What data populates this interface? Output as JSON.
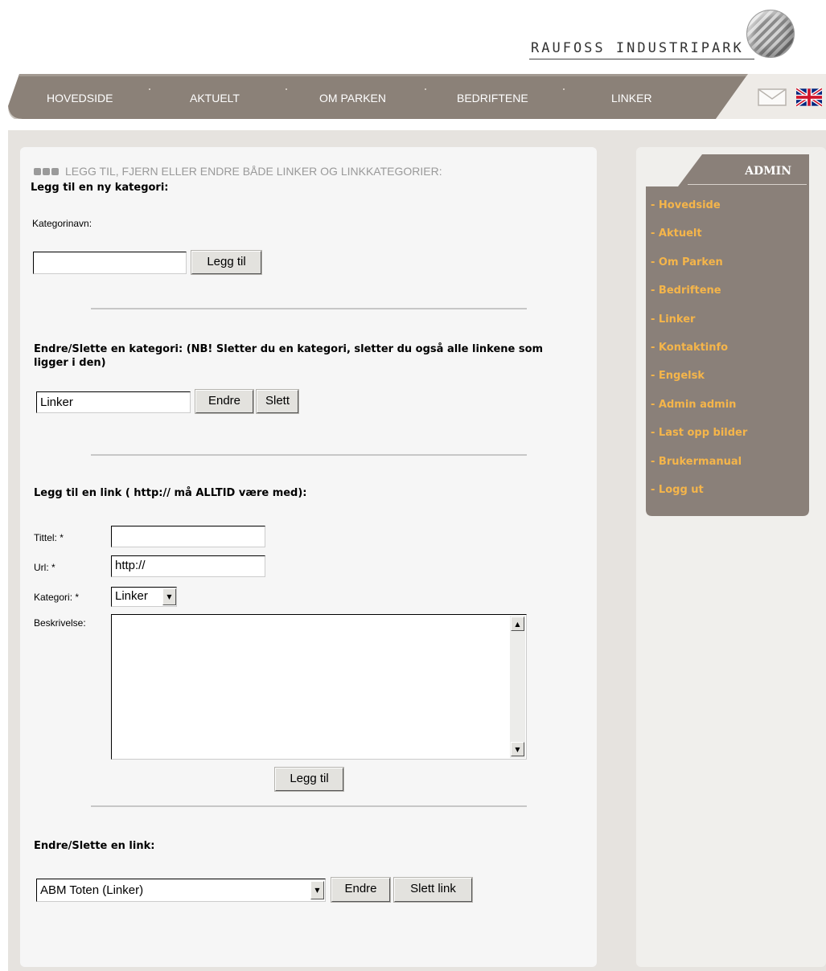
{
  "brand": {
    "logo_text": "RAUFOSS INDUSTRIPARK"
  },
  "nav": {
    "items": [
      {
        "label": "HOVEDSIDE"
      },
      {
        "label": "AKTUELT"
      },
      {
        "label": "OM PARKEN"
      },
      {
        "label": "BEDRIFTENE"
      },
      {
        "label": "LINKER"
      }
    ],
    "mail_icon": "mail-icon",
    "language_icon": "uk-flag-icon"
  },
  "main": {
    "heading": "LEGG TIL, FJERN ELLER ENDRE BÅDE LINKER OG LINKKATEGORIER:",
    "add_category": {
      "title": "Legg til en ny kategori:",
      "name_label": "Kategorinavn:",
      "name_value": "",
      "submit_label": "Legg til"
    },
    "edit_category": {
      "title": "Endre/Slette en kategori: (NB! Sletter du en kategori, sletter du også alle linkene som ligger i den)",
      "value": "Linker",
      "edit_label": "Endre",
      "delete_label": "Slett"
    },
    "add_link": {
      "title": "Legg til en link ( http:// må ALLTID være med):",
      "title_label": "Tittel: *",
      "title_value": "",
      "url_label": "Url: *",
      "url_value": "http://",
      "category_label": "Kategori: *",
      "category_value": "Linker",
      "description_label": "Beskrivelse:",
      "description_value": "",
      "submit_label": "Legg til"
    },
    "edit_link": {
      "title": "Endre/Slette en link:",
      "selected": "ABM Toten (Linker)",
      "edit_label": "Endre",
      "delete_label": "Slett link"
    }
  },
  "admin": {
    "title": "ADMIN",
    "links": [
      {
        "label": "- Hovedside"
      },
      {
        "label": "- Aktuelt"
      },
      {
        "label": "- Om Parken"
      },
      {
        "label": "- Bedriftene"
      },
      {
        "label": "- Linker"
      },
      {
        "label": "- Kontaktinfo"
      },
      {
        "label": "- Engelsk"
      },
      {
        "label": "- Admin admin"
      },
      {
        "label": "- Last opp bilder"
      },
      {
        "label": "- Brukermanual"
      },
      {
        "label": "- Logg ut"
      }
    ]
  },
  "colors": {
    "nav_bar": "#8b8178",
    "admin_bg": "#8a8079",
    "admin_link": "#f5b54a",
    "page_bg": "#e6e3df"
  }
}
